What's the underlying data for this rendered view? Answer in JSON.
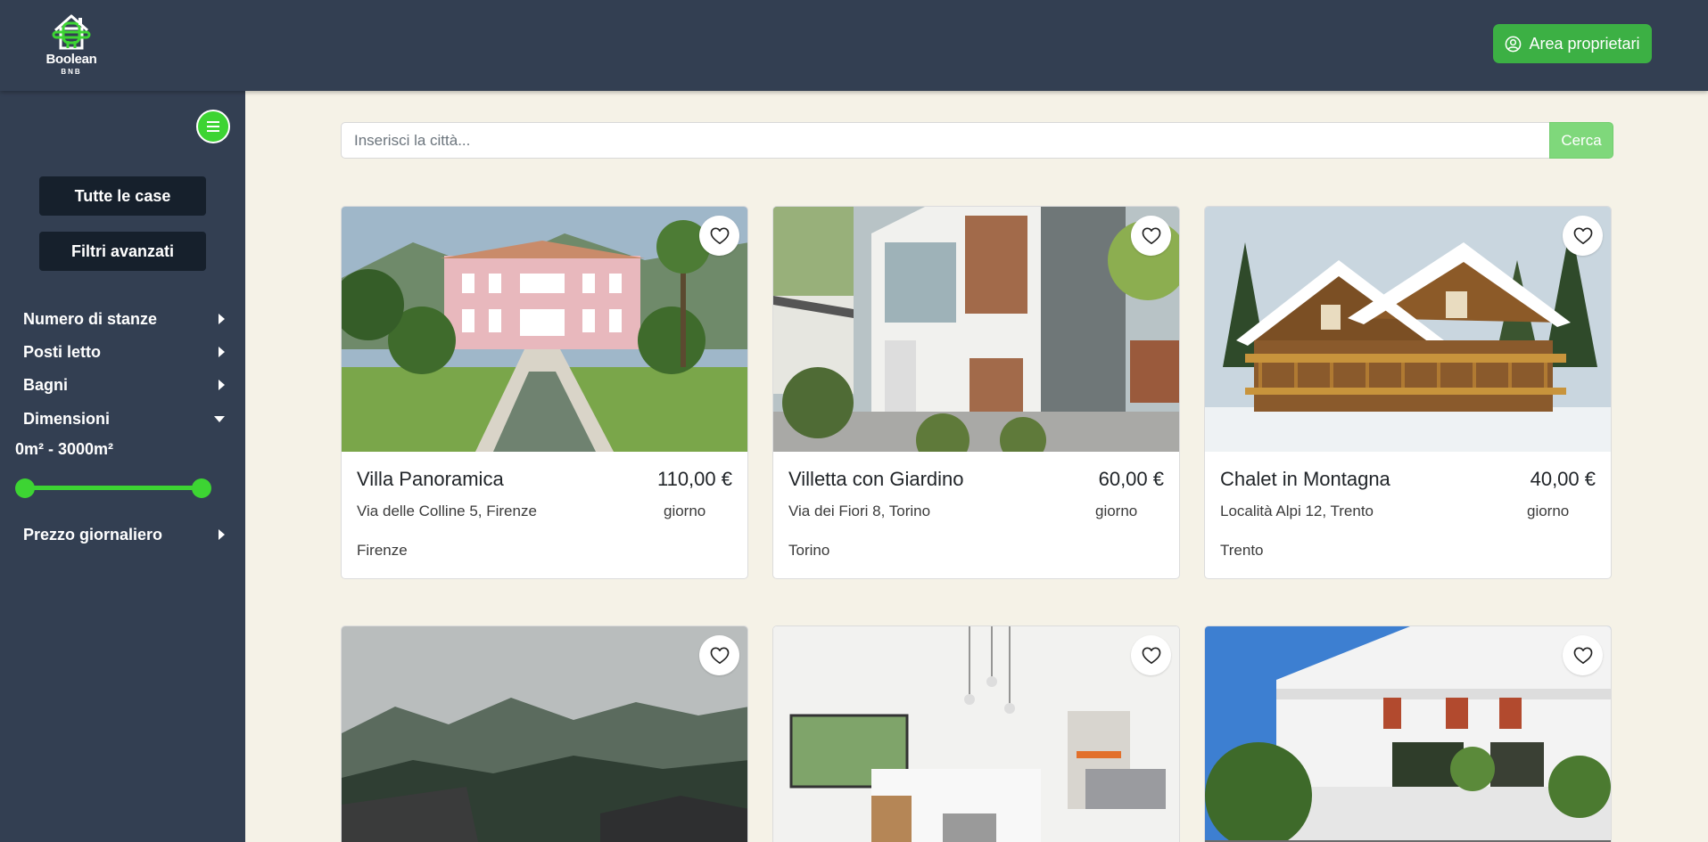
{
  "header": {
    "logo_text": "Boolean",
    "logo_sub": "BNB",
    "owner_button": "Area proprietari"
  },
  "sidebar": {
    "buttons": [
      "Tutte le case",
      "Filtri avanzati"
    ],
    "filters": [
      {
        "label": "Numero di stanze",
        "state": "collapsed"
      },
      {
        "label": "Posti letto",
        "state": "collapsed"
      },
      {
        "label": "Bagni",
        "state": "collapsed"
      },
      {
        "label": "Dimensioni",
        "state": "expanded"
      },
      {
        "label": "Prezzo giornaliero",
        "state": "collapsed"
      }
    ],
    "size_range": {
      "label": "0m² - 3000m²",
      "min": 0,
      "max": 3000,
      "value_min": 0,
      "value_max": 3000
    }
  },
  "search": {
    "placeholder": "Inserisci la città...",
    "button": "Cerca"
  },
  "listings": [
    {
      "title": "Villa Panoramica",
      "price": "110,00 €",
      "unit": "giorno",
      "address": "Via delle Colline 5, Firenze",
      "city": "Firenze"
    },
    {
      "title": "Villetta con Giardino",
      "price": "60,00 €",
      "unit": "giorno",
      "address": "Via dei Fiori 8, Torino",
      "city": "Torino"
    },
    {
      "title": "Chalet in Montagna",
      "price": "40,00 €",
      "unit": "giorno",
      "address": "Località Alpi 12, Trento",
      "city": "Trento"
    }
  ],
  "colors": {
    "header_bg": "#333f52",
    "accent_green": "#3cb044",
    "page_bg": "#f5f2e7"
  }
}
